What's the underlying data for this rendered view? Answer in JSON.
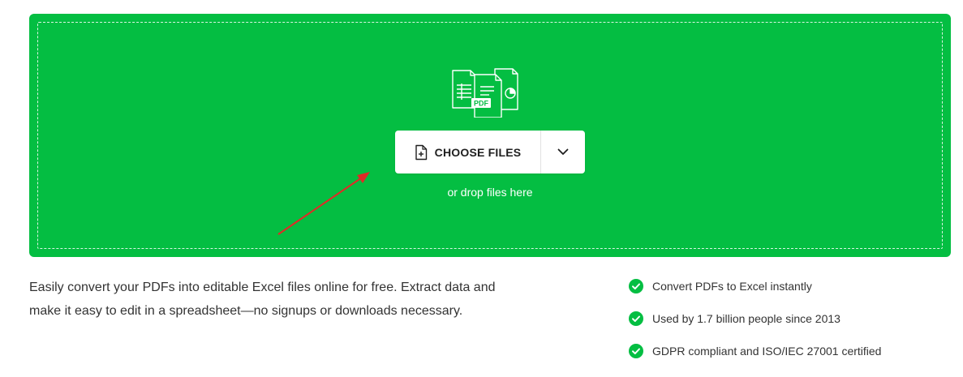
{
  "colors": {
    "brand_green": "#04be42",
    "arrow_red": "#e02b27",
    "text": "#333333"
  },
  "dropzone": {
    "illustration_icon": "pdf-excel-documents-icon",
    "illustration_badge": "PDF",
    "choose_button": {
      "icon": "file-plus-icon",
      "label": "CHOOSE FILES"
    },
    "dropdown_icon": "chevron-down-icon",
    "drop_hint": "or drop files here"
  },
  "annotation": {
    "type": "arrow",
    "color": "red"
  },
  "description": {
    "line1": "Easily convert your PDFs into editable Excel files online for free. Extract data and",
    "line2": "make it easy to edit in a spreadsheet—no signups or downloads necessary."
  },
  "features": [
    {
      "icon": "check-circle-icon",
      "label": "Convert PDFs to Excel instantly"
    },
    {
      "icon": "check-circle-icon",
      "label": "Used by 1.7 billion people since 2013"
    },
    {
      "icon": "check-circle-icon",
      "label": "GDPR compliant and ISO/IEC 27001 certified"
    }
  ]
}
